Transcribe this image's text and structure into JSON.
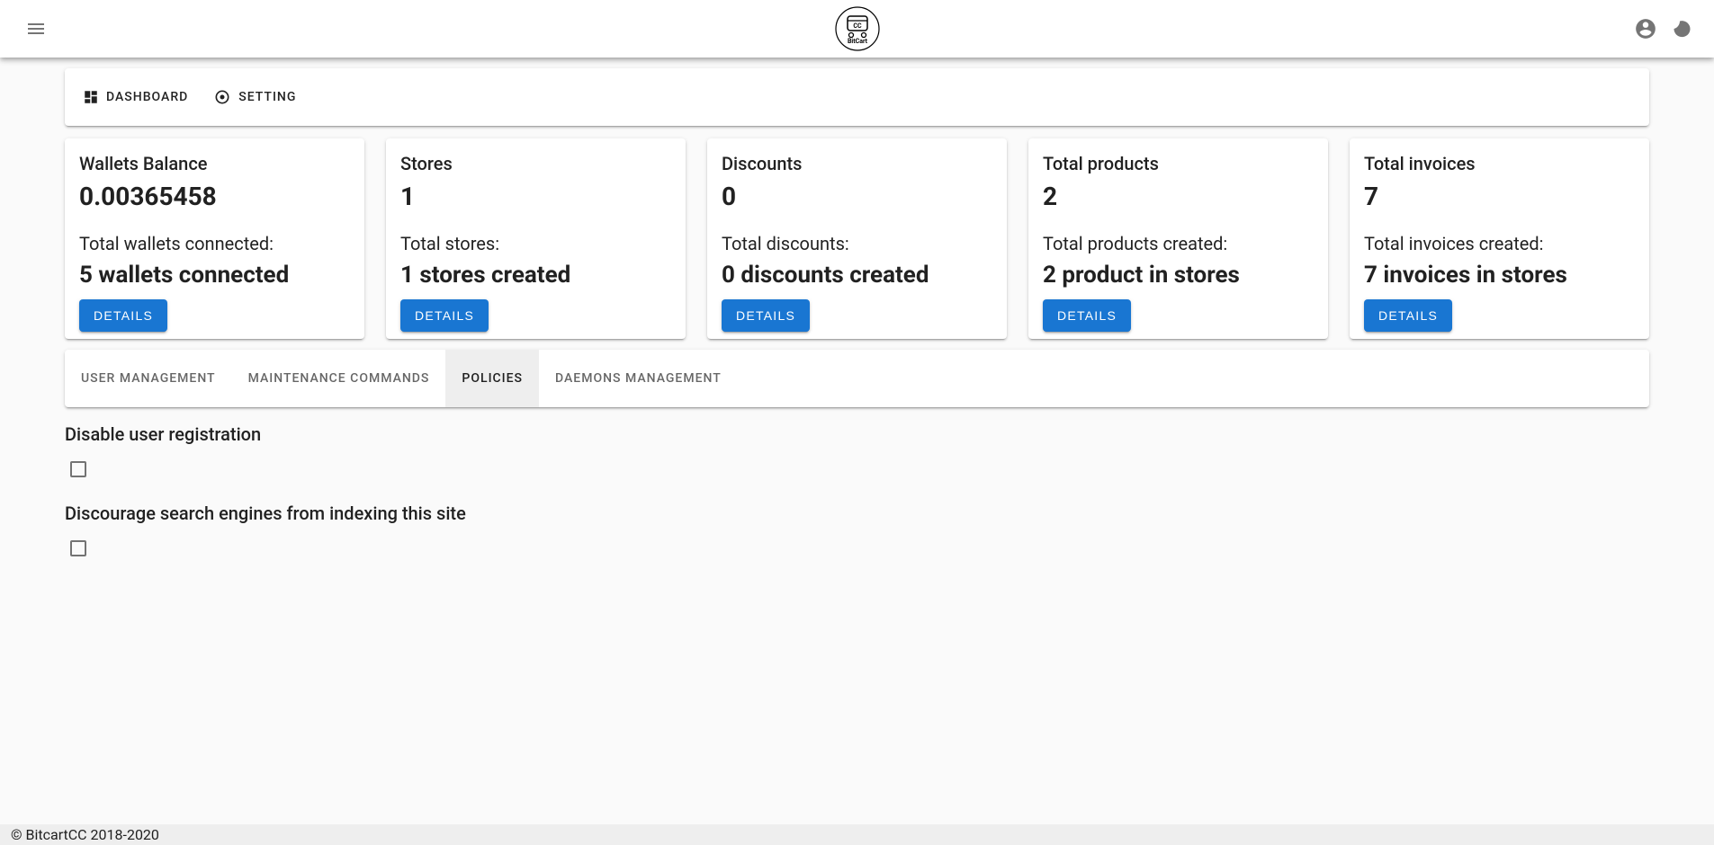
{
  "nav": {
    "dashboard": "Dashboard",
    "setting": "Setting"
  },
  "cards": [
    {
      "title": "Wallets Balance",
      "value": "0.00365458",
      "sub": "Total wallets connected:",
      "detail": "5 wallets connected",
      "button": "Details"
    },
    {
      "title": "Stores",
      "value": "1",
      "sub": "Total stores:",
      "detail": "1 stores created",
      "button": "Details"
    },
    {
      "title": "Discounts",
      "value": "0",
      "sub": "Total discounts:",
      "detail": "0 discounts created",
      "button": "Details"
    },
    {
      "title": "Total products",
      "value": "2",
      "sub": "Total products created:",
      "detail": "2 product in stores",
      "button": "Details"
    },
    {
      "title": "Total invoices",
      "value": "7",
      "sub": "Total invoices created:",
      "detail": "7 invoices in stores",
      "button": "Details"
    }
  ],
  "tabs": {
    "user_management": "User management",
    "maintenance_commands": "Maintenance commands",
    "policies": "Policies",
    "daemons_management": "Daemons management"
  },
  "policies": {
    "disable_registration": "Disable user registration",
    "discourage_search": "Discourage search engines from indexing this site"
  },
  "footer": "© BitcartCC 2018-2020",
  "logo_text": "BitCart"
}
